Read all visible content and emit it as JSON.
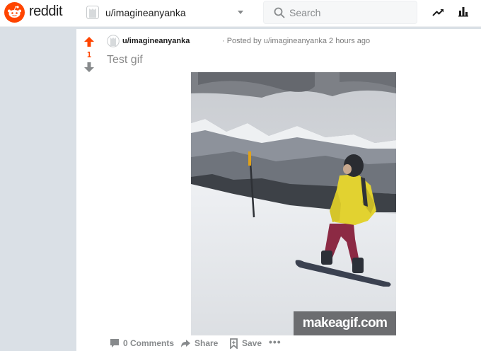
{
  "header": {
    "logo_text": "reddit",
    "subreddit": "u/imagineanyanka",
    "search_placeholder": "Search",
    "icons": [
      "reddit-logo-icon",
      "profile-avatar-icon",
      "chevron-down-icon",
      "search-icon",
      "trending-icon",
      "stats-icon"
    ]
  },
  "post": {
    "score": "1",
    "author": "u/imagineanyanka",
    "posted_by": "· Posted by u/imagineanyanka 2 hours ago",
    "title": "Test gif",
    "media": {
      "watermark": "makeagif.com"
    },
    "actions": {
      "comments": "0 Comments",
      "share": "Share",
      "save": "Save",
      "more": "•••"
    }
  },
  "colors": {
    "brand": "#ff4500",
    "page_background": "#dae0e6",
    "upvote": "#ff4500",
    "downvote": "#878a8c"
  }
}
